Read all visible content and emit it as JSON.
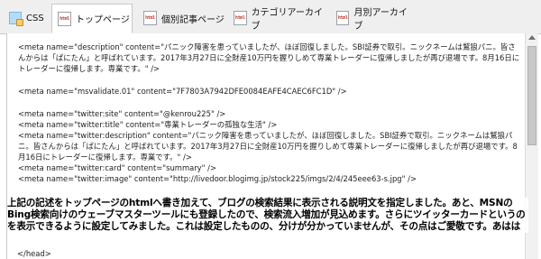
{
  "tabs": [
    {
      "label": "CSS",
      "icon": "css-file-icon"
    },
    {
      "label": "トップページ",
      "icon": "html-file-icon"
    },
    {
      "label": "個別記事ページ",
      "icon": "html-file-icon"
    },
    {
      "label": "カテゴリアーカイブ",
      "icon": "html-file-icon"
    },
    {
      "label": "月別アーカイブ",
      "icon": "html-file-icon"
    }
  ],
  "tab_icon_text": "html",
  "active_tab": "トップページ",
  "code_lines": [
    "<meta name=\"description\" content=\"パニック障害を患っていましたが、ほぼ回復しました。SBI証券で取引。ニックネームは鷲狼パニ。皆さんからは「ぱにたん」と呼ばれています。2017年3月27日に全財産10万円を握りしめて専業トレーダーに復帰しましたが再び退場です。8月16日にトレーダーに復帰します。専業です。\" />",
    "<meta name=\"msvalidate.01\" content=\"7F7803A7942DFE0084EAFE4CAEC6FC1D\" />",
    "<meta name=\"twitter:site\" content=\"@kenrou225\" />",
    "<meta name=\"twitter:title\" content=\"専業トレーダーの孤独な生活\" />",
    "<meta name=\"twitter:description\" content=\"パニック障害を患っていましたが、ほぼ回復しました。SBI証券で取引。ニックネームは鷲狼パニ。皆さんからは「ぱにたん」と呼ばれています。2017年3月27日に全財産10万円を握りしめて専業トレーダーに復帰しましたが再び退場です。8月16日にトレーダーに復帰します。専業です。\" />",
    "<meta name=\"twitter:card\" content=\"summary\" />",
    "<meta name=\"twitter:image\" content=\"http://livedoor.blogimg.jp/stock225/imgs/2/4/245eee63-s.jpg\" />"
  ],
  "overlay_note": "上記の記述をトップページのhtmlへ書き加えて、ブログの検索結果に表示される説明文を指定しました。あと、MSNのBing検索向けのウェーブマスターツールにも登録したので、検索流入増加が見込めます。さらにツイッターカードというのを表示できるように設定してみました。これは設定したものの、分けが分かっていませんが、その点はご愛敬です。あはは",
  "code_tail": "</head>",
  "colors": {
    "icon_accent": "#c0392b",
    "tabbar_bg": "#efefef",
    "border": "#c9c9c9"
  }
}
